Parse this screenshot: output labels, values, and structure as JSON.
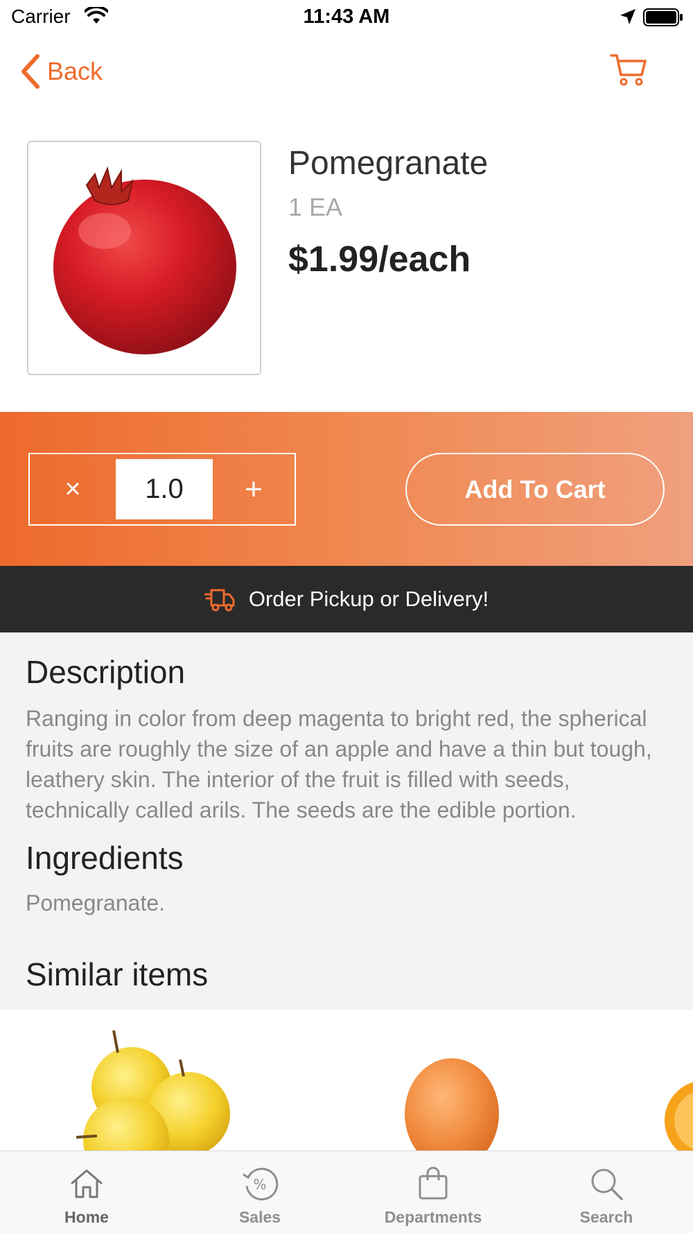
{
  "status_bar": {
    "carrier": "Carrier",
    "time": "11:43 AM"
  },
  "nav": {
    "back_label": "Back"
  },
  "product": {
    "name": "Pomegranate",
    "unit": "1 EA",
    "price": "$1.99/each"
  },
  "quantity": {
    "remove_symbol": "×",
    "value": "1.0",
    "add_symbol": "+"
  },
  "actions": {
    "add_to_cart_label": "Add To Cart"
  },
  "banner": {
    "text": "Order Pickup or Delivery!"
  },
  "description": {
    "heading": "Description",
    "body": "Ranging in color from deep magenta to bright red, the spherical fruits are roughly the size of an apple and have a thin but tough, leathery skin. The interior of the fruit is filled with seeds, technically called arils. The seeds are the edible portion."
  },
  "ingredients": {
    "heading": "Ingredients",
    "body": "Pomegranate."
  },
  "similar": {
    "heading": "Similar items"
  },
  "tab_bar": {
    "tabs": [
      {
        "label": "Home",
        "icon": "home-icon",
        "active": true
      },
      {
        "label": "Sales",
        "icon": "sales-icon",
        "active": false
      },
      {
        "label": "Departments",
        "icon": "departments-icon",
        "active": false
      },
      {
        "label": "Search",
        "icon": "search-icon",
        "active": false
      }
    ]
  },
  "colors": {
    "accent": "#ee6a2c",
    "banner_bg": "#2a2a2a",
    "section_bg": "#f3f3f3"
  }
}
